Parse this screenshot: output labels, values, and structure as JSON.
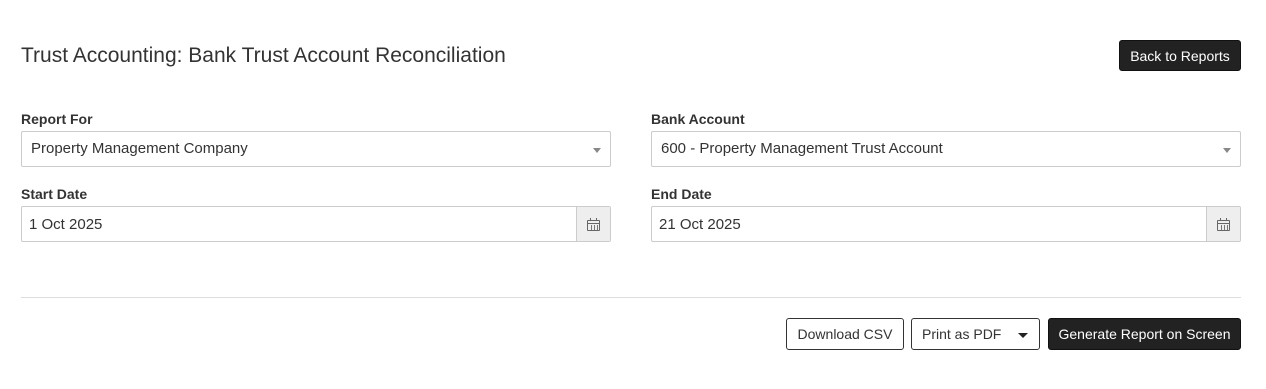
{
  "header": {
    "title": "Trust Accounting: Bank Trust Account Reconciliation",
    "back_label": "Back to Reports"
  },
  "form": {
    "report_for": {
      "label": "Report For",
      "value": "Property Management Company"
    },
    "bank_account": {
      "label": "Bank Account",
      "value": "600 - Property Management Trust Account"
    },
    "start_date": {
      "label": "Start Date",
      "value": "1 Oct 2025"
    },
    "end_date": {
      "label": "End Date",
      "value": "21 Oct 2025"
    }
  },
  "actions": {
    "download_csv": "Download CSV",
    "print_pdf": "Print as PDF",
    "generate": "Generate Report on Screen"
  },
  "icons": {
    "select_arrow": "chevron-down-icon",
    "date_picker": "calendar-icon",
    "dropdown_caret": "caret-down-icon"
  },
  "colors": {
    "primary_button": "#222222",
    "border": "#cccccc",
    "addon_bg": "#eeeeee"
  }
}
